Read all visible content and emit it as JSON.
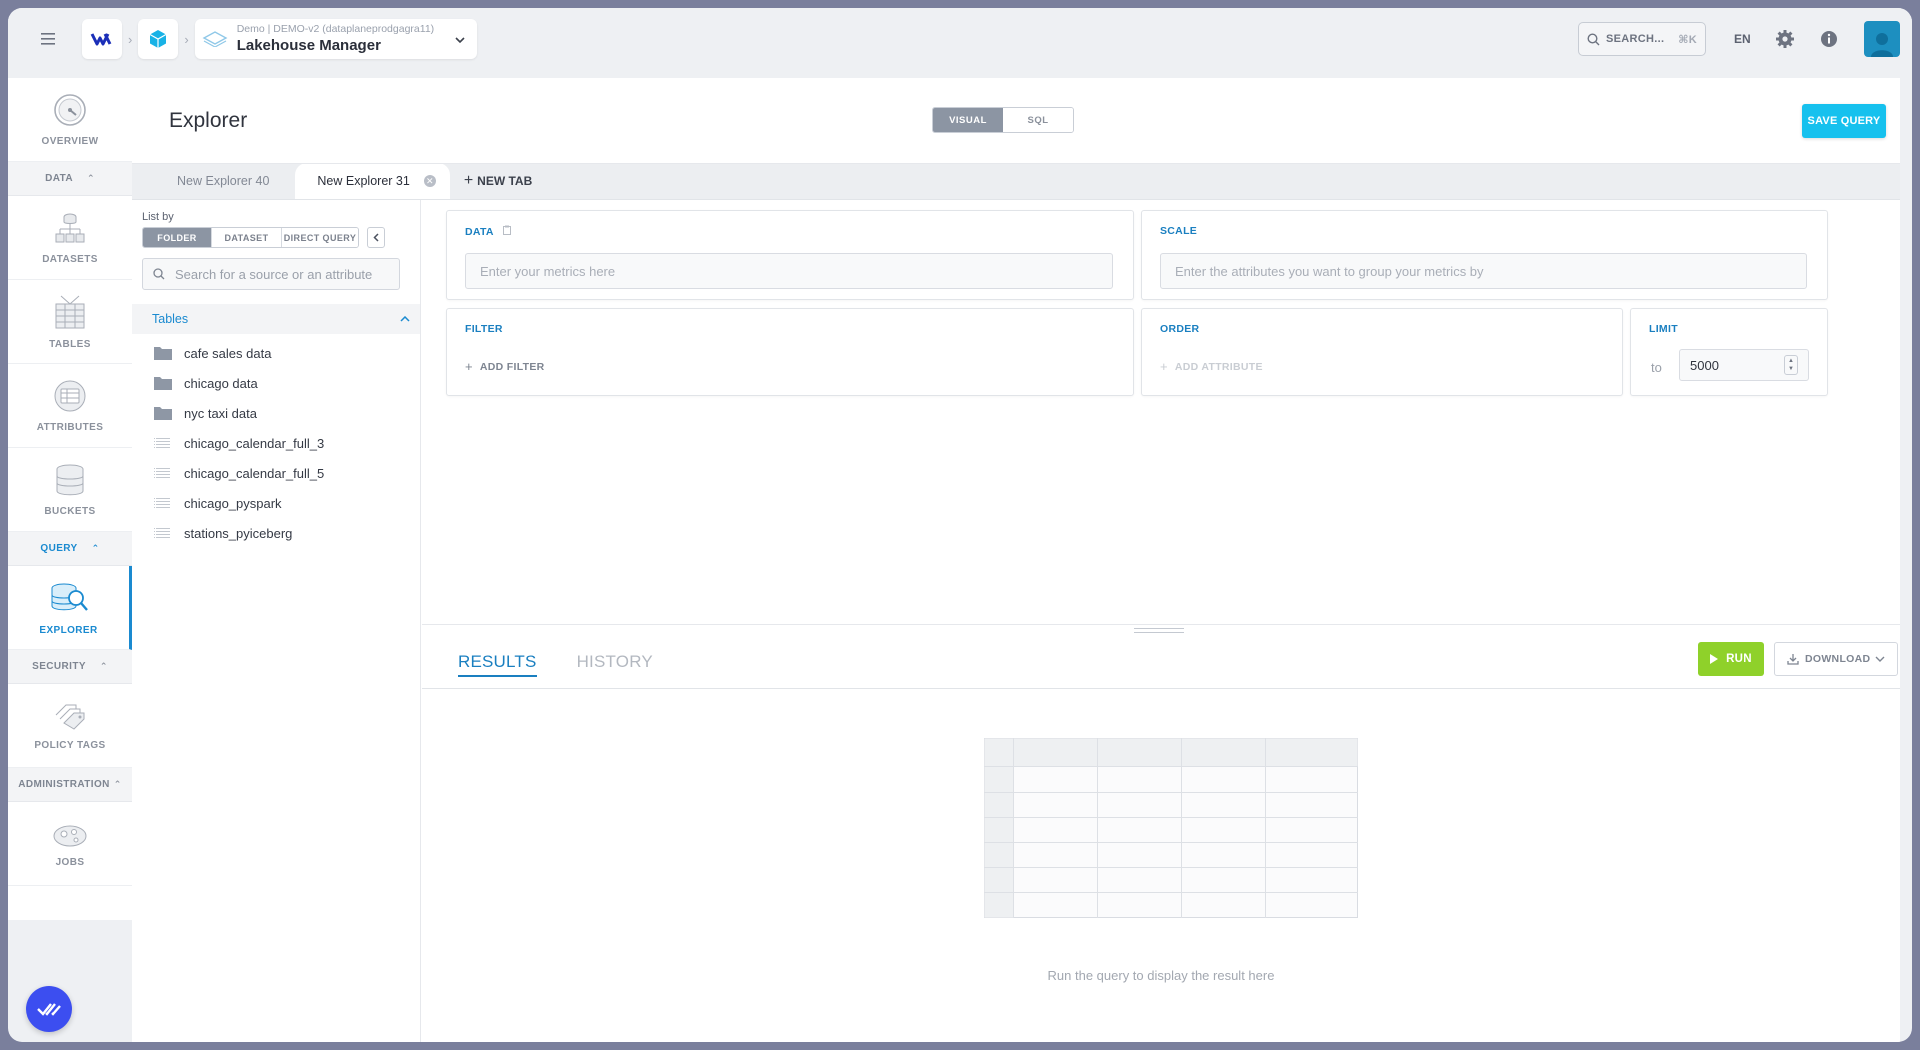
{
  "topbar": {
    "project_sub": "Demo | DEMO-v2 (dataplaneprodgagra11)",
    "project_title": "Lakehouse Manager",
    "search_label": "SEARCH...",
    "search_shortcut": "⌘K",
    "language": "EN"
  },
  "sidebar": {
    "overview": "OVERVIEW",
    "section_data": "DATA",
    "datasets": "DATASETS",
    "tables": "TABLES",
    "attributes": "ATTRIBUTES",
    "buckets": "BUCKETS",
    "section_query": "QUERY",
    "explorer": "EXPLORER",
    "section_security": "SECURITY",
    "policy_tags": "POLICY TAGS",
    "section_administration": "ADMINISTRATION",
    "jobs": "JOBS"
  },
  "header": {
    "title": "Explorer",
    "mode_visual": "VISUAL",
    "mode_sql": "SQL",
    "save_query": "SAVE QUERY"
  },
  "tabs": {
    "items": [
      "New Explorer 40",
      "New Explorer 31"
    ],
    "active_index": 1,
    "new_tab": "NEW TAB"
  },
  "left_panel": {
    "list_by_label": "List by",
    "list_by_options": [
      "FOLDER",
      "DATASET",
      "DIRECT QUERY"
    ],
    "list_by_selected": "FOLDER",
    "search_placeholder": "Search for a source or an attribute",
    "tables_header": "Tables",
    "folders": [
      "cafe sales data",
      "chicago data",
      "nyc taxi data"
    ],
    "tables": [
      "chicago_calendar_full_3",
      "chicago_calendar_full_5",
      "chicago_pyspark",
      "stations_pyiceberg"
    ]
  },
  "query_builder": {
    "data_title": "DATA",
    "data_placeholder": "Enter your metrics here",
    "scale_title": "SCALE",
    "scale_placeholder": "Enter the attributes you want to group your metrics by",
    "filter_title": "FILTER",
    "add_filter": "ADD FILTER",
    "order_title": "ORDER",
    "add_attribute": "ADD ATTRIBUTE",
    "limit_title": "LIMIT",
    "limit_to": "to",
    "limit_value": "5000"
  },
  "results": {
    "tab_results": "RESULTS",
    "tab_history": "HISTORY",
    "run": "RUN",
    "download": "DOWNLOAD",
    "empty_message": "Run the query to display the result here"
  },
  "colors": {
    "accent": "#1a7fc0",
    "save_button": "#16c1ee",
    "run_button": "#8fd12a",
    "fab": "#3c4ef0"
  }
}
